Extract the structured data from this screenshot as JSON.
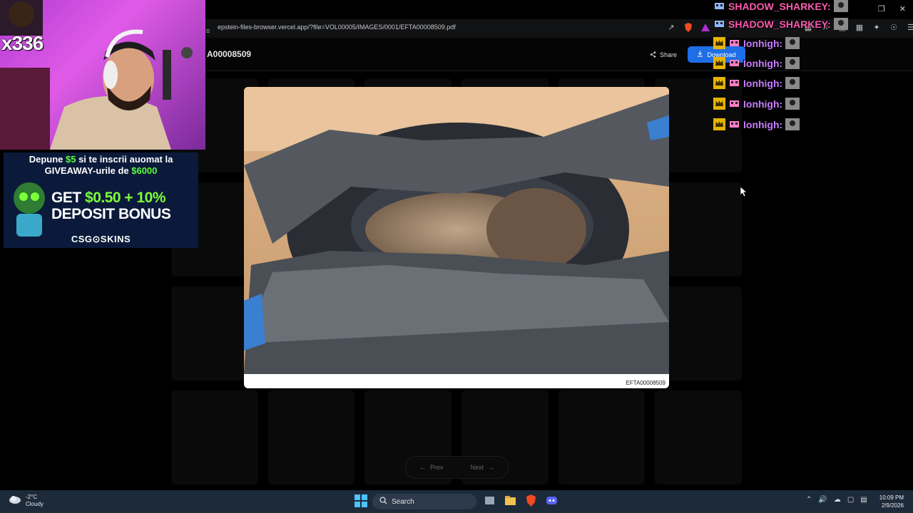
{
  "browser": {
    "url": "epstein-files-browser.vercel.app/?file=VOL00005/IMAGES/0001/EFTA00008509.pdf"
  },
  "app": {
    "file_title": "A00008509",
    "share_label": "Share",
    "download_label": "Download"
  },
  "viewer": {
    "caption": "EFTA00008509"
  },
  "pager": {
    "prev_label": "Prev",
    "next_label": "Next"
  },
  "stream": {
    "combo_count": "x336"
  },
  "ad": {
    "line1_pre": "Depune ",
    "line1_amount": "$5",
    "line1_post": " si te inscrii auomat la",
    "line2_pre": "GIVEAWAY-urile de ",
    "line2_amount": "$6000",
    "big1_pre": "GET ",
    "big1_amount": "$0.50 + 10%",
    "big2": "DEPOSIT BONUS",
    "brand": "CSG⊙SKINS"
  },
  "chat": {
    "messages": [
      {
        "name": "SHADOW_SHARKEY:",
        "color": "#ff5ab0"
      },
      {
        "name": "SHADOW_SHARKEY:",
        "color": "#ff5ab0"
      },
      {
        "name": "Ionhigh:",
        "color": "#c77dff"
      },
      {
        "name": "Ionhigh:",
        "color": "#c77dff"
      },
      {
        "name": "Ionhigh:",
        "color": "#c77dff"
      },
      {
        "name": "Ionhigh:",
        "color": "#c77dff"
      },
      {
        "name": "Ionhigh:",
        "color": "#c77dff"
      }
    ]
  },
  "taskbar": {
    "temperature": "-2°C",
    "weather": "Cloudy",
    "search_label": "Search",
    "time": "10:09 PM",
    "date": "2/9/2026"
  },
  "colors": {
    "accent": "#1e6ee8",
    "taskbar": "#1c2a3a"
  }
}
